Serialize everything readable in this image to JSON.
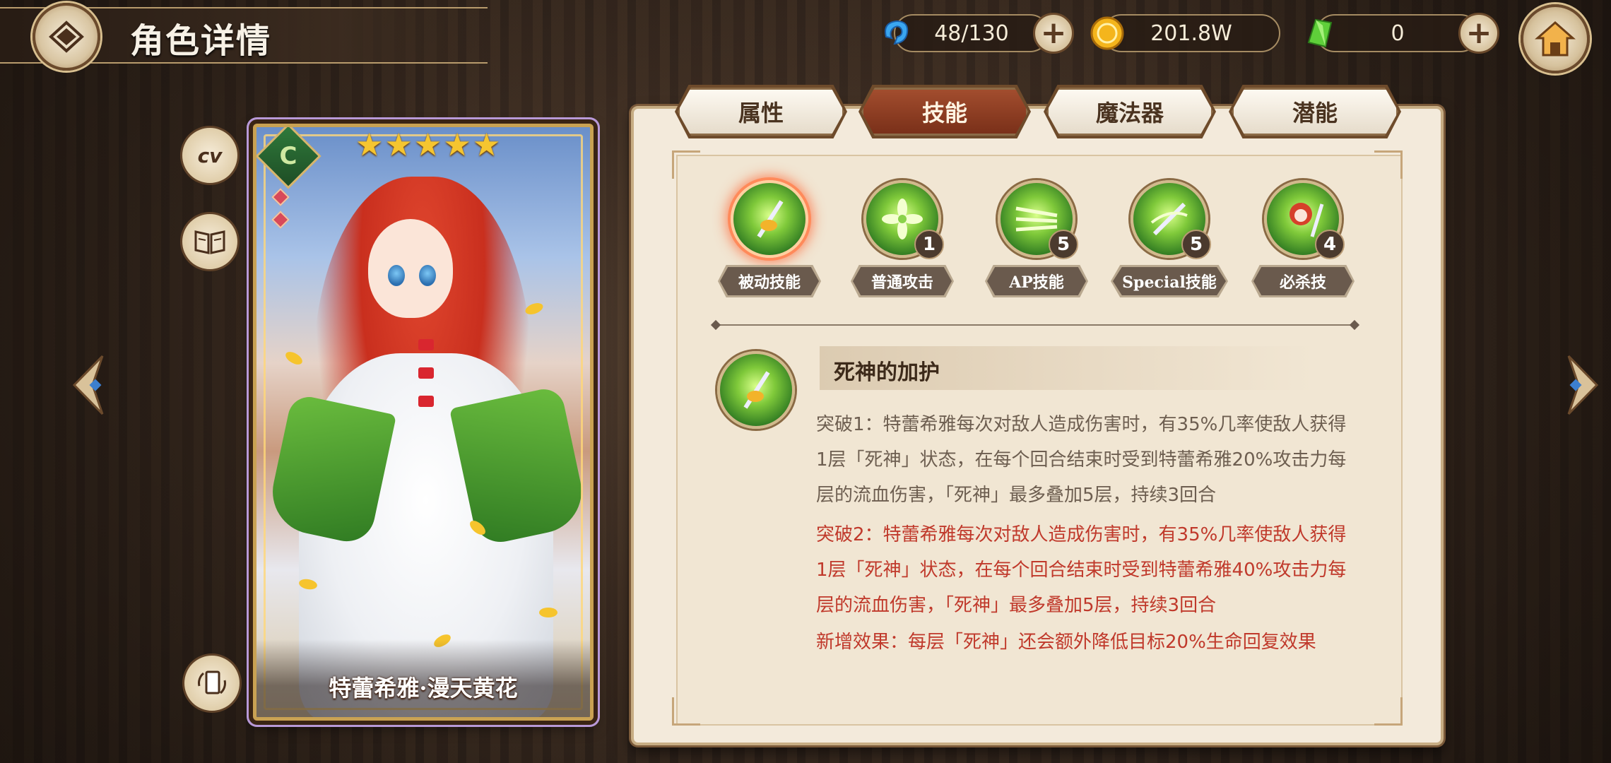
{
  "header": {
    "title": "角色详情"
  },
  "currency": {
    "stamina": {
      "value": "48/130",
      "icon": "blue-spirit-icon"
    },
    "gold": {
      "value": "201.8W",
      "icon": "gold-coin-icon"
    },
    "gem": {
      "value": "0",
      "icon": "green-crystal-icon"
    }
  },
  "side_buttons": {
    "cv_label": "cv"
  },
  "card": {
    "name": "特蕾希雅·漫天黄花",
    "stars": [
      "★",
      "★",
      "★",
      "★",
      "★"
    ],
    "badge": "C"
  },
  "tabs": [
    {
      "label": "属性",
      "active": false
    },
    {
      "label": "技能",
      "active": true
    },
    {
      "label": "魔法器",
      "active": false
    },
    {
      "label": "潜能",
      "active": false
    }
  ],
  "skills": [
    {
      "label": "被动技能",
      "level": "",
      "selected": true
    },
    {
      "label": "普通攻击",
      "level": "1",
      "selected": false
    },
    {
      "label": "AP技能",
      "level": "5",
      "selected": false
    },
    {
      "label": "Special技能",
      "level": "5",
      "selected": false
    },
    {
      "label": "必杀技",
      "level": "4",
      "selected": false
    }
  ],
  "detail": {
    "title": "死神的加护",
    "break1": "突破1：特蕾希雅每次对敌人造成伤害时，有35%几率使敌人获得\n1层「死神」状态，在每个回合结束时受到特蕾希雅20%攻击力每\n层的流血伤害，「死神」最多叠加5层，持续3回合",
    "break2": "突破2：特蕾希雅每次对敌人造成伤害时，有35%几率使敌人获得\n1层「死神」状态，在每个回合结束时受到特蕾希雅40%攻击力每\n层的流血伤害，「死神」最多叠加5层，持续3回合",
    "new_effect": "新增效果：每层「死神」还会额外降低目标20%生命回复效果"
  },
  "colors": {
    "accent_active_tab": "#8a3a1f",
    "highlight_text": "#c0392b",
    "body_text": "#6d5e50"
  }
}
